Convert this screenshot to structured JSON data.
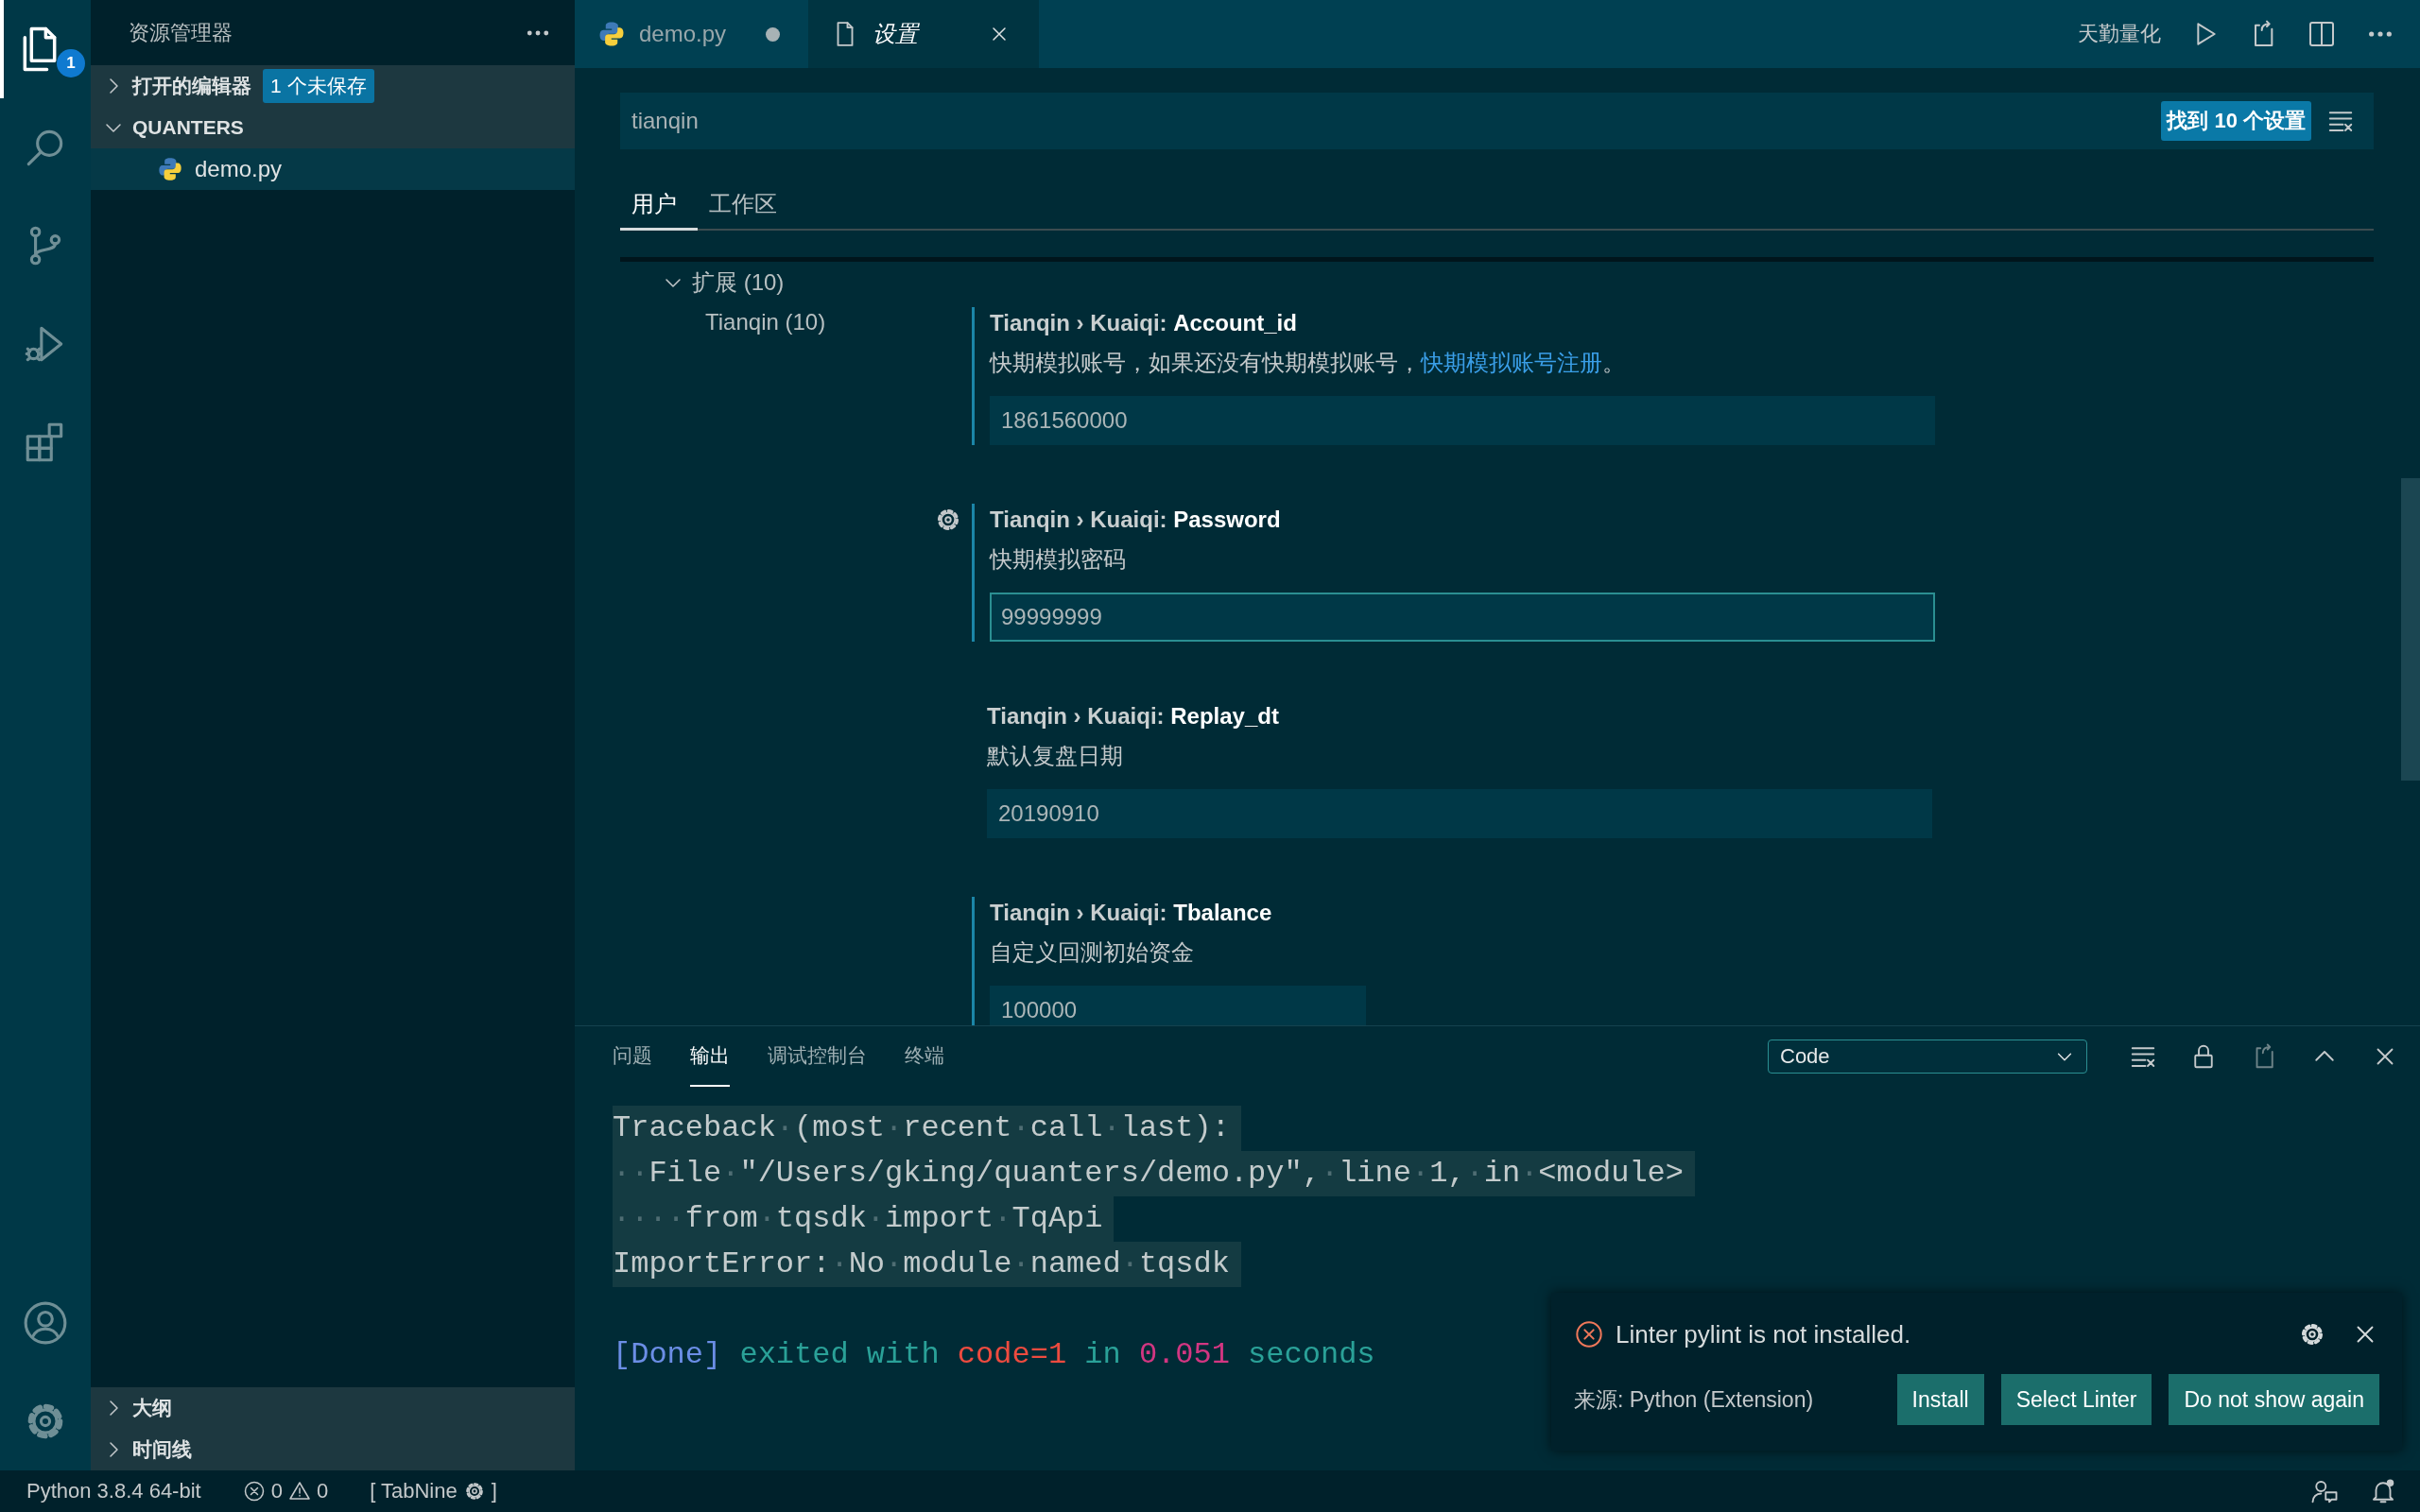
{
  "activity_bar": {
    "items": [
      {
        "kind": "explorer",
        "selected": true,
        "badge": "1"
      },
      {
        "kind": "search",
        "selected": false
      },
      {
        "kind": "source-control",
        "selected": false
      },
      {
        "kind": "run",
        "selected": false
      },
      {
        "kind": "extensions",
        "selected": false
      }
    ],
    "bottom_items": [
      {
        "kind": "account"
      },
      {
        "kind": "manage"
      }
    ]
  },
  "sidebar": {
    "title": "资源管理器",
    "sections": [
      {
        "label": "打开的编辑器",
        "expanded": false,
        "badge": "1 个未保存"
      },
      {
        "label": "QUANTERS",
        "expanded": true,
        "files": [
          {
            "label": "demo.py",
            "selected": true
          }
        ]
      }
    ],
    "bottom_sections": [
      {
        "label": "大纲",
        "expanded": false
      },
      {
        "label": "时间线",
        "expanded": false
      }
    ]
  },
  "tabs": [
    {
      "label": "demo.py",
      "kind": "python",
      "selected": false,
      "modified": true,
      "preview": false
    },
    {
      "label": "设置",
      "kind": "file",
      "selected": true,
      "modified": false,
      "preview": true
    }
  ],
  "editor_actions": {
    "label": "天勤量化"
  },
  "settings": {
    "search": {
      "value": "tianqin"
    },
    "result_badge": "找到 10 个设置",
    "scope_tabs": [
      {
        "label": "用户",
        "selected": true
      },
      {
        "label": "工作区",
        "selected": false
      }
    ],
    "tree": [
      {
        "label": "扩展 (10)",
        "expanded": true,
        "children": [
          {
            "label": "Tianqin (10)"
          }
        ]
      }
    ],
    "items": [
      {
        "category": "Tianqin › Kuaiqi: ",
        "name": "Account_id",
        "description": "快期模拟账号，如果还没有快期模拟账号，",
        "link": "快期模拟账号注册",
        "description_after": "。",
        "value": "1861560000",
        "kind": "string",
        "modified": true,
        "focused": false,
        "hovered": false
      },
      {
        "category": "Tianqin › Kuaiqi: ",
        "name": "Password",
        "description": "快期模拟密码",
        "value": "99999999",
        "kind": "string",
        "modified": true,
        "focused": true,
        "hovered": true
      },
      {
        "category": "Tianqin › Kuaiqi: ",
        "name": "Replay_dt",
        "description": "默认复盘日期",
        "value": "20190910",
        "kind": "string",
        "modified": false,
        "focused": false,
        "hovered": false
      },
      {
        "category": "Tianqin › Kuaiqi: ",
        "name": "Tbalance",
        "description": "自定义回测初始资金",
        "value": "100000",
        "kind": "number",
        "modified": true,
        "focused": false,
        "hovered": false
      }
    ]
  },
  "panel": {
    "tabs": [
      {
        "label": "问题",
        "selected": false
      },
      {
        "label": "输出",
        "selected": true
      },
      {
        "label": "调试控制台",
        "selected": false
      },
      {
        "label": "终端",
        "selected": false
      }
    ],
    "channel": {
      "value": "Code"
    },
    "lines": [
      {
        "selected": true,
        "blank_before": false,
        "segments": [
          {
            "text": "Traceback·(most·recent·call·last):",
            "color": "#c3cbcc"
          }
        ]
      },
      {
        "selected": true,
        "blank_before": false,
        "segments": [
          {
            "text": "··File·\"/Users/gking/quanters/demo.py\",·line·1,·in·<module>",
            "color": "#c3cbcc"
          }
        ]
      },
      {
        "selected": true,
        "blank_before": false,
        "segments": [
          {
            "text": "····from·tqsdk·import·TqApi",
            "color": "#c3cbcc"
          }
        ]
      },
      {
        "selected": true,
        "blank_before": false,
        "segments": [
          {
            "text": "ImportError:·No·module·named·tqsdk",
            "color": "#c3cbcc"
          }
        ]
      },
      {
        "selected": false,
        "blank_before": true,
        "segments": [
          {
            "text": "[Done]",
            "color": "#6b8ee6"
          },
          {
            "text": " exited with ",
            "color": "#2aa198"
          },
          {
            "text": "code=1",
            "color": "#ee4b3f"
          },
          {
            "text": " in ",
            "color": "#2aa198"
          },
          {
            "text": "0.051",
            "color": "#d33682"
          },
          {
            "text": " seconds",
            "color": "#2aa198"
          }
        ]
      }
    ]
  },
  "notification": {
    "kind": "error",
    "message": "Linter pylint is not installed.",
    "source": "来源: Python (Extension)",
    "buttons": [
      "Install",
      "Select Linter",
      "Do not show again"
    ]
  },
  "status_bar": {
    "interpreter": "Python 3.8.4 64-bit",
    "errors": "0",
    "warnings": "0",
    "tabnine_before": "[ TabNine",
    "tabnine_after": "]",
    "notifications_unread": true
  }
}
